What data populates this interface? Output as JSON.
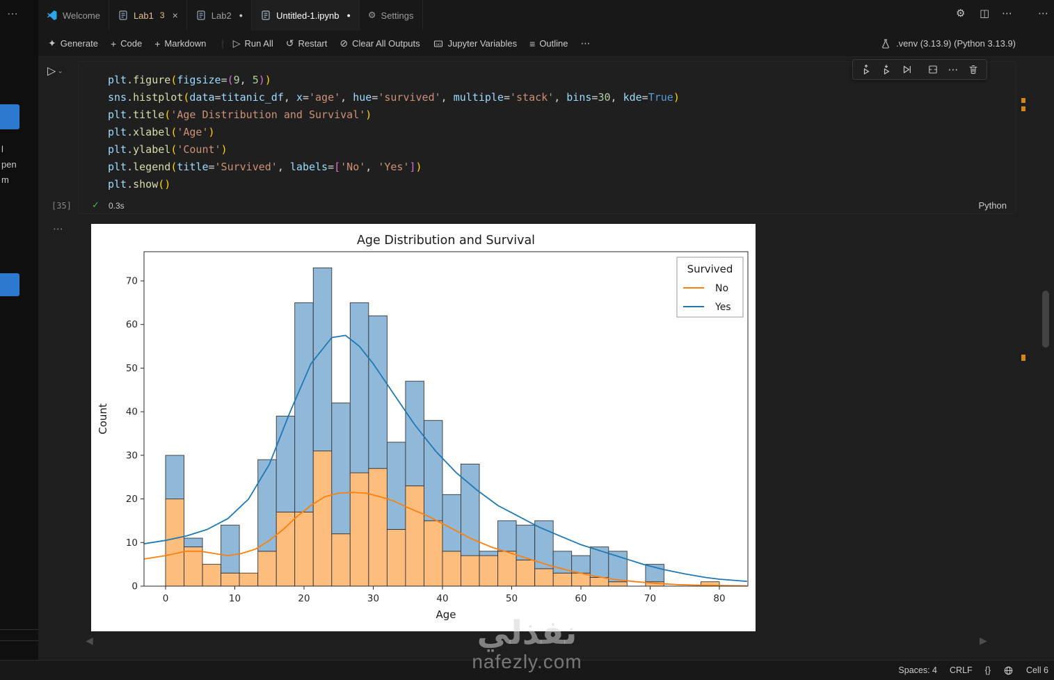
{
  "icons": {
    "more": "⋯",
    "sparkle": "✦",
    "plus": "+",
    "run": "▷",
    "restart": "↺",
    "clear": "⊘",
    "outline": "≡",
    "gear": "⚙",
    "split_editor": "◫",
    "check": "✓",
    "chevron_down": "⌄",
    "dirty_dot": "●",
    "close": "×",
    "arrow_left": "◀",
    "arrow_right": "▶"
  },
  "left_strip": {
    "more": "⋯",
    "fragments": [
      "l",
      "pen",
      "m"
    ]
  },
  "tabs": {
    "items": [
      {
        "label": "Welcome"
      },
      {
        "label": "Lab1",
        "badge": "3"
      },
      {
        "label": "Lab2"
      },
      {
        "label": "Untitled-1.ipynb"
      },
      {
        "label": "Settings"
      }
    ]
  },
  "toolbar": {
    "generate": "Generate",
    "code": "Code",
    "markdown": "Markdown",
    "run_all": "Run All",
    "restart": "Restart",
    "clear_all_outputs": "Clear All Outputs",
    "jupyter_variables": "Jupyter Variables",
    "outline": "Outline",
    "env": ".venv (3.13.9) (Python 3.13.9)"
  },
  "cell": {
    "execution_count": "[35]",
    "duration": "0.3s",
    "language": "Python",
    "code_lines": [
      [
        [
          "v",
          "plt"
        ],
        [
          "p",
          "."
        ],
        [
          "f",
          "figure"
        ],
        [
          "b1",
          "("
        ],
        [
          "v",
          "figsize"
        ],
        [
          "p",
          "="
        ],
        [
          "b2",
          "("
        ],
        [
          "n",
          "9"
        ],
        [
          "p",
          ", "
        ],
        [
          "n",
          "5"
        ],
        [
          "b2",
          ")"
        ],
        [
          "b1",
          ")"
        ]
      ],
      [
        [
          "v",
          "sns"
        ],
        [
          "p",
          "."
        ],
        [
          "f",
          "histplot"
        ],
        [
          "b1",
          "("
        ],
        [
          "v",
          "data"
        ],
        [
          "p",
          "="
        ],
        [
          "v",
          "titanic_df"
        ],
        [
          "p",
          ", "
        ],
        [
          "v",
          "x"
        ],
        [
          "p",
          "="
        ],
        [
          "s",
          "'age'"
        ],
        [
          "p",
          ", "
        ],
        [
          "v",
          "hue"
        ],
        [
          "p",
          "="
        ],
        [
          "s",
          "'survived'"
        ],
        [
          "p",
          ", "
        ],
        [
          "v",
          "multiple"
        ],
        [
          "p",
          "="
        ],
        [
          "s",
          "'stack'"
        ],
        [
          "p",
          ", "
        ],
        [
          "v",
          "bins"
        ],
        [
          "p",
          "="
        ],
        [
          "n",
          "30"
        ],
        [
          "p",
          ", "
        ],
        [
          "v",
          "kde"
        ],
        [
          "p",
          "="
        ],
        [
          "k",
          "True"
        ],
        [
          "b1",
          ")"
        ]
      ],
      [
        [
          "v",
          "plt"
        ],
        [
          "p",
          "."
        ],
        [
          "f",
          "title"
        ],
        [
          "b1",
          "("
        ],
        [
          "s",
          "'Age Distribution and Survival'"
        ],
        [
          "b1",
          ")"
        ]
      ],
      [
        [
          "v",
          "plt"
        ],
        [
          "p",
          "."
        ],
        [
          "f",
          "xlabel"
        ],
        [
          "b1",
          "("
        ],
        [
          "s",
          "'Age'"
        ],
        [
          "b1",
          ")"
        ]
      ],
      [
        [
          "v",
          "plt"
        ],
        [
          "p",
          "."
        ],
        [
          "f",
          "ylabel"
        ],
        [
          "b1",
          "("
        ],
        [
          "s",
          "'Count'"
        ],
        [
          "b1",
          ")"
        ]
      ],
      [
        [
          "v",
          "plt"
        ],
        [
          "p",
          "."
        ],
        [
          "f",
          "legend"
        ],
        [
          "b1",
          "("
        ],
        [
          "v",
          "title"
        ],
        [
          "p",
          "="
        ],
        [
          "s",
          "'Survived'"
        ],
        [
          "p",
          ", "
        ],
        [
          "v",
          "labels"
        ],
        [
          "p",
          "="
        ],
        [
          "b2",
          "["
        ],
        [
          "s",
          "'No'"
        ],
        [
          "p",
          ", "
        ],
        [
          "s",
          "'Yes'"
        ],
        [
          "b2",
          "]"
        ],
        [
          "b1",
          ")"
        ]
      ],
      [
        [
          "v",
          "plt"
        ],
        [
          "p",
          "."
        ],
        [
          "f",
          "show"
        ],
        [
          "b1",
          "("
        ],
        [
          "b1",
          ")"
        ]
      ]
    ]
  },
  "chart_data": {
    "type": "bar",
    "subtype": "stacked-histogram-with-kde",
    "title": "Age Distribution and Survival",
    "axes": {
      "xlabel": "Age",
      "ylabel": "Count",
      "xticks": [
        0,
        10,
        20,
        30,
        40,
        50,
        60,
        70,
        80
      ],
      "yticks": [
        0,
        10,
        20,
        30,
        40,
        50,
        60,
        70
      ],
      "xlim": [
        -4,
        84
      ],
      "ylim": [
        0,
        76.65
      ],
      "grid": false
    },
    "legend": {
      "title": "Survived",
      "position": "upper right",
      "entries": [
        {
          "label": "No",
          "color": "#ff7f0e"
        },
        {
          "label": "Yes",
          "color": "#1f77b4"
        }
      ]
    },
    "colors": {
      "no_bar": "#fcbd7d",
      "yes_bar": "#8fb8d9",
      "bar_edge": "#363636",
      "no_line": "#ff7f0e",
      "yes_line": "#1f77b4"
    },
    "bins": {
      "start": 0,
      "bin_width": 2.6667,
      "no": [
        20,
        9,
        5,
        3,
        3,
        8,
        17,
        17,
        31,
        12,
        26,
        27,
        13,
        23,
        15,
        8,
        7,
        7,
        8,
        6,
        4,
        3,
        3,
        2,
        1,
        0,
        1,
        0,
        0,
        1
      ],
      "yes": [
        10,
        2,
        0,
        11,
        0,
        21,
        22,
        48,
        42,
        30,
        39,
        35,
        20,
        24,
        23,
        13,
        21,
        1,
        7,
        8,
        11,
        5,
        4,
        7,
        7,
        0,
        4,
        0,
        0,
        0
      ]
    },
    "kde": {
      "no": [
        [
          -4,
          6
        ],
        [
          0,
          7
        ],
        [
          3,
          8
        ],
        [
          5,
          8
        ],
        [
          7,
          7.5
        ],
        [
          9,
          7
        ],
        [
          11,
          7.5
        ],
        [
          13,
          8.5
        ],
        [
          15,
          10.5
        ],
        [
          17,
          13
        ],
        [
          19,
          16
        ],
        [
          21,
          18.5
        ],
        [
          23,
          20.5
        ],
        [
          25,
          21.3
        ],
        [
          27,
          21.5
        ],
        [
          29,
          21.3
        ],
        [
          31,
          20.5
        ],
        [
          33,
          19.5
        ],
        [
          35,
          18
        ],
        [
          38,
          16
        ],
        [
          41,
          13.5
        ],
        [
          44,
          11
        ],
        [
          47,
          9
        ],
        [
          50,
          7.5
        ],
        [
          53,
          6
        ],
        [
          56,
          4.5
        ],
        [
          59,
          3.3
        ],
        [
          62,
          2.3
        ],
        [
          65,
          1.5
        ],
        [
          68,
          1
        ],
        [
          71,
          0.6
        ],
        [
          74,
          0.35
        ],
        [
          77,
          0.2
        ],
        [
          80,
          0.12
        ],
        [
          84,
          0.05
        ]
      ],
      "yes": [
        [
          -4,
          9.5
        ],
        [
          0,
          10.5
        ],
        [
          3,
          11.5
        ],
        [
          6,
          13
        ],
        [
          9,
          15.5
        ],
        [
          12,
          20
        ],
        [
          15,
          28
        ],
        [
          18,
          40
        ],
        [
          21,
          51
        ],
        [
          24,
          57
        ],
        [
          26,
          57.5
        ],
        [
          28,
          55
        ],
        [
          30,
          51
        ],
        [
          33,
          44
        ],
        [
          36,
          37
        ],
        [
          39,
          31
        ],
        [
          42,
          26
        ],
        [
          45,
          22
        ],
        [
          48,
          18.5
        ],
        [
          51,
          16
        ],
        [
          54,
          13.5
        ],
        [
          57,
          11.5
        ],
        [
          60,
          9.5
        ],
        [
          63,
          8
        ],
        [
          66,
          6.5
        ],
        [
          69,
          5
        ],
        [
          72,
          3.8
        ],
        [
          75,
          2.8
        ],
        [
          78,
          2
        ],
        [
          80,
          1.6
        ],
        [
          84,
          1.1
        ]
      ]
    }
  },
  "status_bar": {
    "spaces": "Spaces: 4",
    "eol": "CRLF",
    "brackets": "{}",
    "cell_indicator": "Cell 6"
  },
  "watermark": {
    "arabic": "نفذلي",
    "latin": "nafezly.com"
  }
}
